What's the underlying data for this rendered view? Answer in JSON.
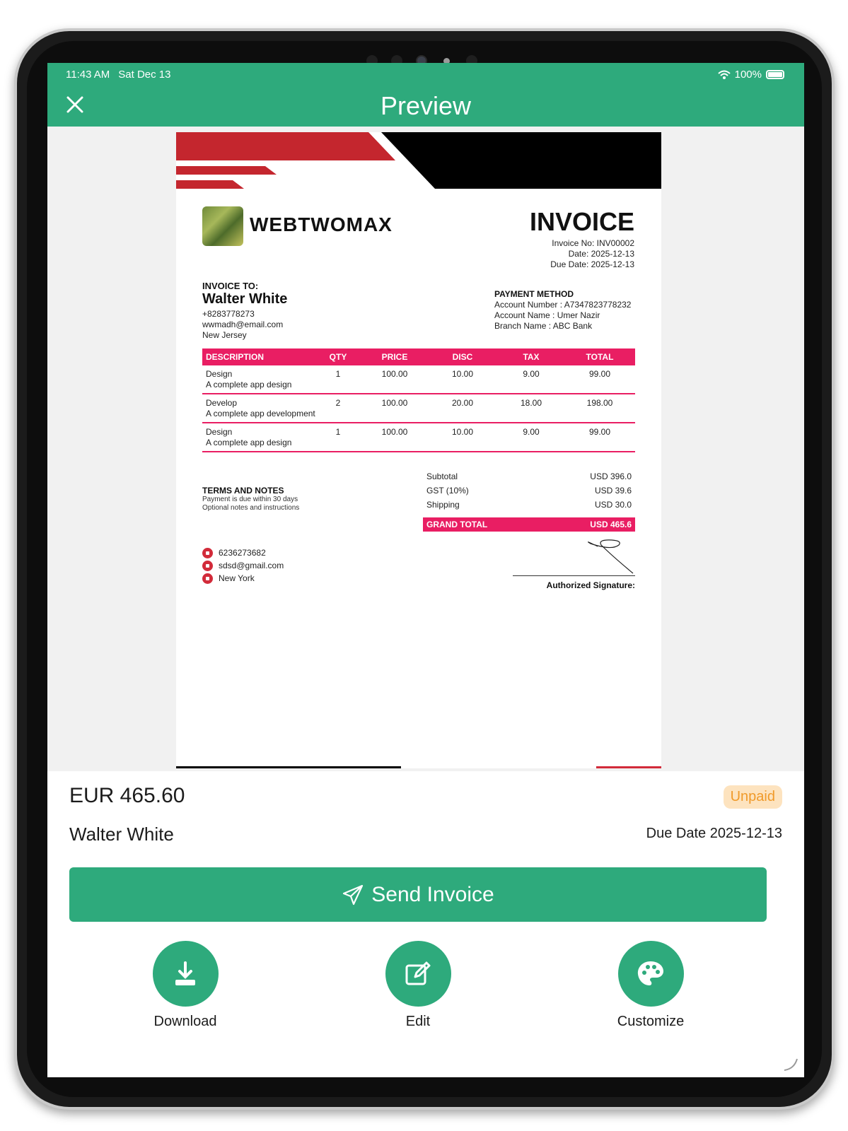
{
  "status_bar": {
    "time": "11:43 AM",
    "date": "Sat Dec 13",
    "battery": "100%"
  },
  "nav": {
    "title": "Preview",
    "close_icon": "close-icon"
  },
  "invoice": {
    "company": "WEBTWOMAX",
    "title": "INVOICE",
    "invoice_no": "Invoice No: INV00002",
    "date": "Date: 2025-12-13",
    "due_date": "Due Date: 2025-12-13",
    "bill_to_label": "INVOICE TO:",
    "client_name": "Walter White",
    "client_phone": "+8283778273",
    "client_email": "wwmadh@email.com",
    "client_location": "New Jersey",
    "payment": {
      "title": "PAYMENT METHOD",
      "account_number": "Account Number : A7347823778232",
      "account_name": "Account Name : Umer Nazir",
      "branch_name": "Branch Name : ABC Bank"
    },
    "headers": [
      "DESCRIPTION",
      "QTY",
      "PRICE",
      "DISC",
      "TAX",
      "TOTAL"
    ],
    "rows": [
      {
        "title": "Design",
        "desc": "A complete app design",
        "qty": "1",
        "price": "100.00",
        "disc": "10.00",
        "tax": "9.00",
        "total": "99.00"
      },
      {
        "title": "Develop",
        "desc": "A complete app development",
        "qty": "2",
        "price": "100.00",
        "disc": "20.00",
        "tax": "18.00",
        "total": "198.00"
      },
      {
        "title": "Design",
        "desc": "A complete app design",
        "qty": "1",
        "price": "100.00",
        "disc": "10.00",
        "tax": "9.00",
        "total": "99.00"
      }
    ],
    "totals": {
      "subtotal_label": "Subtotal",
      "subtotal": "USD 396.0",
      "gst_label": "GST (10%)",
      "gst": "USD 39.6",
      "shipping_label": "Shipping",
      "shipping": "USD 30.0",
      "grand_label": "GRAND TOTAL",
      "grand": "USD 465.6"
    },
    "terms": {
      "title": "TERMS AND NOTES",
      "line1": "Payment is due within 30 days",
      "line2": "Optional notes and instructions"
    },
    "contact": {
      "phone": "6236273682",
      "email": "sdsd@gmail.com",
      "location": "New York"
    },
    "signature_label": "Authorized Signature:"
  },
  "summary": {
    "amount": "EUR 465.60",
    "status": "Unpaid",
    "client": "Walter White",
    "due": "Due Date 2025-12-13"
  },
  "actions": {
    "send": "Send Invoice",
    "download": "Download",
    "edit": "Edit",
    "customize": "Customize"
  },
  "colors": {
    "primary": "#2eaa7c",
    "accent": "#e91e63",
    "red": "#d22b3a",
    "unpaid_bg": "#fde3bf",
    "unpaid_text": "#f09a2a"
  }
}
